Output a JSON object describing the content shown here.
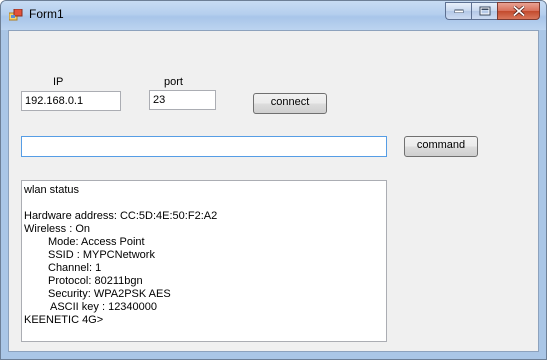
{
  "window": {
    "title": "Form1"
  },
  "form": {
    "ip_label": "IP",
    "ip_value": "192.168.0.1",
    "port_label": "port",
    "port_value": "23",
    "connect_label": "connect",
    "command_value": "",
    "command_label": "command"
  },
  "output": {
    "lines": [
      {
        "text": "wlan status",
        "indent": 0
      },
      {
        "text": "",
        "indent": 0
      },
      {
        "text": "Hardware address: CC:5D:4E:50:F2:A2",
        "indent": 0
      },
      {
        "text": "Wireless : On",
        "indent": 0
      },
      {
        "text": "Mode: Access Point",
        "indent": 1
      },
      {
        "text": "SSID : MYPCNetwork",
        "indent": 1
      },
      {
        "text": "Channel: 1",
        "indent": 1
      },
      {
        "text": "Protocol: 80211bgn",
        "indent": 1
      },
      {
        "text": "Security: WPA2PSK AES",
        "indent": 1
      },
      {
        "text": "ASCII key : 12340000",
        "indent": 2
      },
      {
        "text": "KEENETIC 4G>",
        "indent": 0
      }
    ]
  }
}
